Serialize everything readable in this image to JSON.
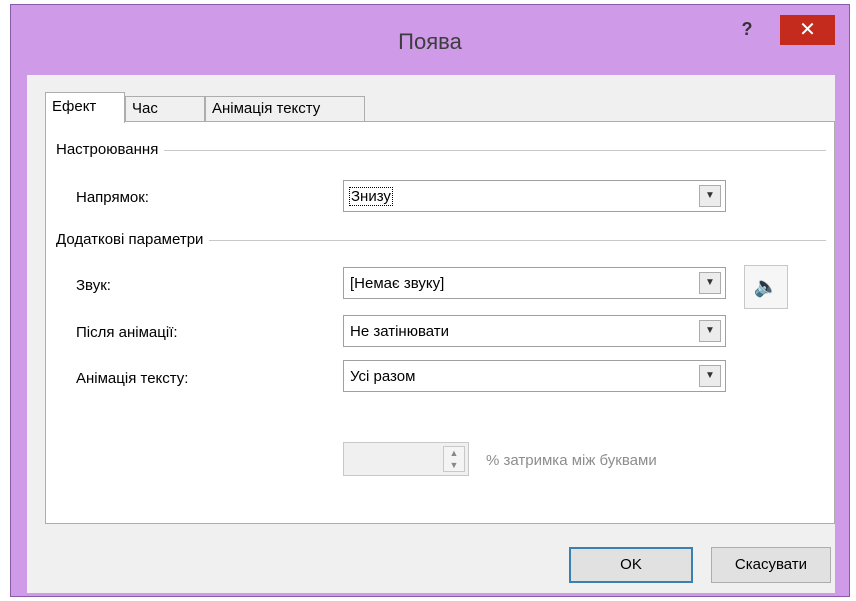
{
  "window": {
    "title": "Поява",
    "help_label": "?",
    "close_label": "✕"
  },
  "tabs": [
    {
      "label": "Ефект",
      "active": true
    },
    {
      "label": "Час",
      "active": false
    },
    {
      "label": "Анімація тексту",
      "active": false
    }
  ],
  "settings": {
    "group_label": "Настроювання",
    "direction_label": "Напрямок:",
    "direction_value": "Знизу"
  },
  "extra": {
    "group_label": "Додаткові параметри",
    "sound_label": "Звук:",
    "sound_value": "[Немає звуку]",
    "after_label": "Після анімації:",
    "after_value": "Не затінювати",
    "text_anim_label": "Анімація тексту:",
    "text_anim_value": "Усі разом",
    "delay_value": "",
    "delay_label": "% затримка між буквами",
    "sound_icon": "speaker-icon"
  },
  "buttons": {
    "ok": "OK",
    "cancel": "Скасувати"
  }
}
